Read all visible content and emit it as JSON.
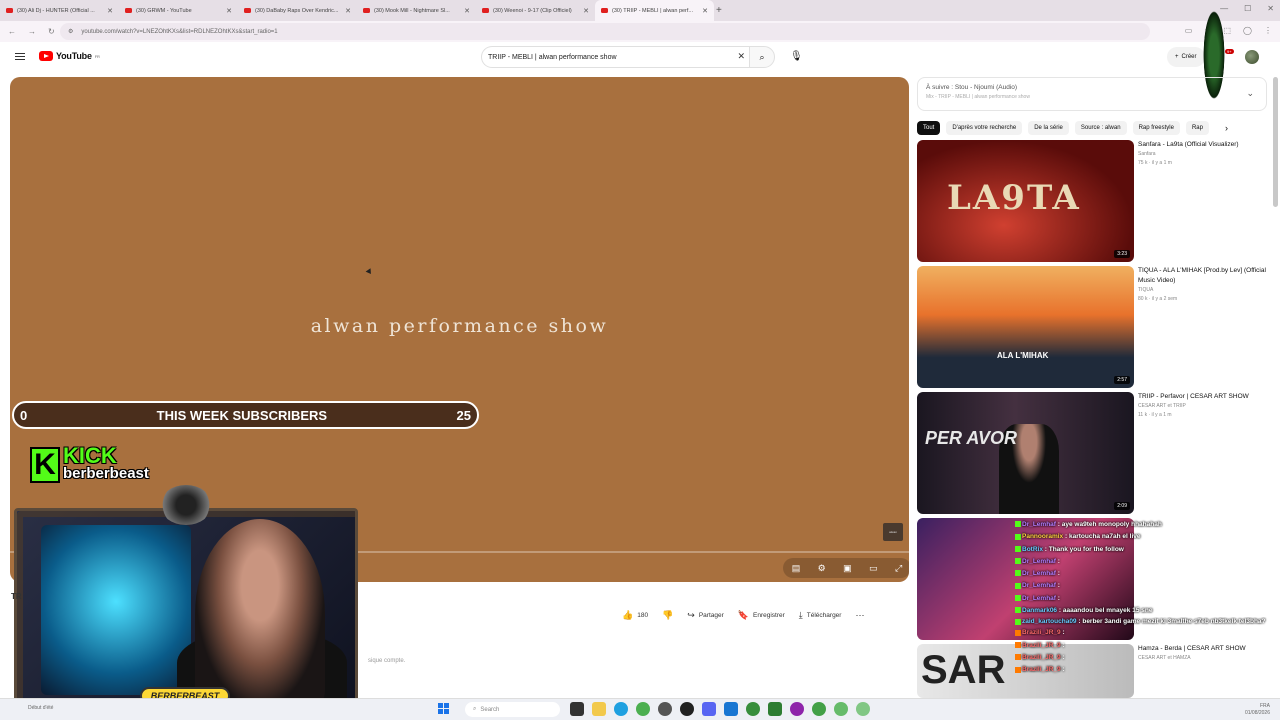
{
  "browser": {
    "tabs": [
      {
        "title": "(30) Ali Dj - HUNTER (Official ..."
      },
      {
        "title": "(30) GRWM - YouTube"
      },
      {
        "title": "(30) DaBaby Raps Over Kendric..."
      },
      {
        "title": "(30) Mook Mill - Nightmare Sl..."
      },
      {
        "title": "(30) Weenoi - 9-17 (Clip Officiel)"
      },
      {
        "title": "(30) TRIIP - MEBLI | alwan perf..."
      }
    ],
    "url": "youtube.com/watch?v=LNEZOhtKXs&list=RDLNEZOhtKXs&start_radio=1"
  },
  "youtube": {
    "logo": "YouTube",
    "logo_sup": "FR",
    "search_value": "TRIIP - MEBLI | alwan performance show",
    "create_label": "Créer",
    "notif_count": "9+"
  },
  "player": {
    "title_text": "alwan performance show",
    "watermark": "alwan"
  },
  "overlay": {
    "sub_left": "0",
    "sub_title": "THIS WEEK SUBSCRIBERS",
    "sub_right": "25",
    "kick_brand": "KICK",
    "kick_user": "berberbeast",
    "cam_label": "BERBERBEAST"
  },
  "video": {
    "title_stub": "TR",
    "likes": "180",
    "share": "Partager",
    "save": "Enregistrer",
    "download": "Télécharger",
    "desc_snip": "sique compte."
  },
  "up_next": {
    "label": "À suivre :",
    "track": "Stou - Njoumi (Audio)",
    "mix": "Mix - TRIIP - MEBLI | alwan performance show"
  },
  "chips": [
    "Tout",
    "D'après votre recherche",
    "De la série",
    "Source : alwan",
    "Rap freestyle",
    "Rap"
  ],
  "recs": [
    {
      "title": "Sanfara - La9ta (Official Visualizer)",
      "channel": "Sanfara",
      "stats": "75 k · il y a 1 m",
      "duration": "3:23",
      "thumb_text": "LA9TA"
    },
    {
      "title": "TIQUA - ALA L'MIHAK [Prod.by Lev] (Official Music Video)",
      "channel": "TIQUA",
      "stats": "80 k · il y a 2 sem",
      "duration": "2:57",
      "thumb_text": "ALA L'MIHAK"
    },
    {
      "title": "TRIIP - Perfavor | CESAR ART SHOW",
      "channel": "CESAR ART et TRIIP",
      "stats": "11 k · il y a 1 m",
      "duration": "2:09",
      "thumb_text": "PER AVOR"
    },
    {
      "title": "",
      "channel": "",
      "stats": "",
      "duration": "",
      "thumb_text": ""
    },
    {
      "title": "Hamza - Berda | CESAR ART SHOW",
      "channel": "CESAR ART et HAMZA",
      "stats": "",
      "duration": "",
      "thumb_text": "SAR"
    }
  ],
  "chat": [
    {
      "user": "Dr_Lemhaf",
      "msg": ": aye wa9teh monopoly hhahahah"
    },
    {
      "user": "Pannooramix",
      "msg": ": kartoucha na7ah el live"
    },
    {
      "user": "BotRix",
      "msg": ": Thank you for the follow"
    },
    {
      "user": "Dr_Lemhaf",
      "msg": ":"
    },
    {
      "user": "Dr_Lemhaf",
      "msg": ":"
    },
    {
      "user": "Dr_Lemhaf",
      "msg": ":"
    },
    {
      "user": "Dr_Lemhaf",
      "msg": ":"
    },
    {
      "user": "Danmark06",
      "msg": ": aaaandou bel mnayek 15 sne"
    },
    {
      "user": "zaid_kartoucha09",
      "msg": ": berber 3andi game mezit ki 3malthe s7eb nb3tkelk tel3bha?"
    },
    {
      "user": "Brazili_JR_9",
      "msg": ":"
    },
    {
      "user": "Brazili_JR_9",
      "msg": ":"
    },
    {
      "user": "Brazili_JR_9",
      "msg": ":"
    },
    {
      "user": "Brazili_JR_9",
      "msg": ":"
    }
  ],
  "taskbar": {
    "left_text": "Début d'été",
    "search_placeholder": "Search",
    "lang": "FRA",
    "date": "01/08/2026"
  }
}
